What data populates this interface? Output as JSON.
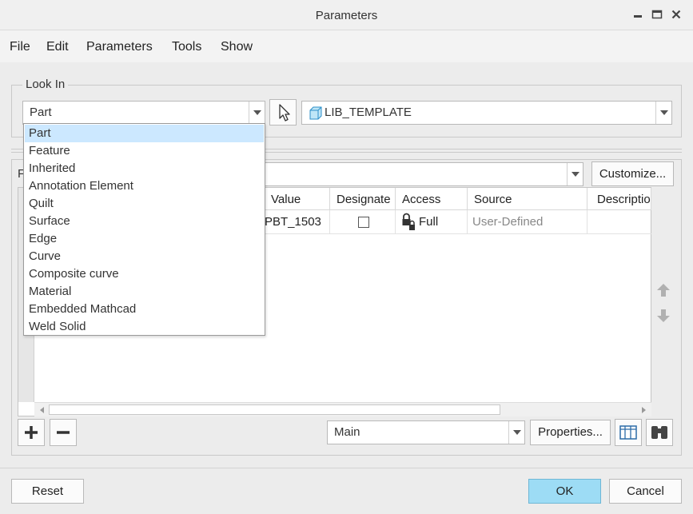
{
  "window": {
    "title": "Parameters"
  },
  "menu": [
    "File",
    "Edit",
    "Parameters",
    "Tools",
    "Show"
  ],
  "look_in": {
    "label": "Look In",
    "type_value": "Part",
    "object_value": "LIB_TEMPLATE",
    "options": [
      "Part",
      "Feature",
      "Inherited",
      "Annotation Element",
      "Quilt",
      "Surface",
      "Edge",
      "Curve",
      "Composite curve",
      "Material",
      "Embedded Mathcad",
      "Weld Solid"
    ]
  },
  "filter": {
    "label_partial": "F",
    "customize_label": "Customize..."
  },
  "table": {
    "headers": [
      "Value",
      "Designate",
      "Access",
      "Source",
      "Descriptio"
    ],
    "rows": [
      {
        "value": "PBT_1503",
        "designate": false,
        "access": "Full",
        "source": "User-Defined",
        "description": ""
      }
    ]
  },
  "bottom_bar": {
    "view_value": "Main",
    "properties_label": "Properties..."
  },
  "footer": {
    "reset_label": "Reset",
    "ok_label": "OK",
    "cancel_label": "Cancel"
  },
  "colors": {
    "selected_item_bg": "#cce8ff",
    "ok_button_bg": "#9ddcf5",
    "access_grey": "#888888"
  }
}
